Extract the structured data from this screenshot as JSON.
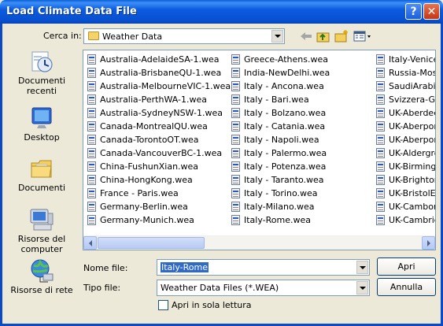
{
  "window": {
    "title": "Load Climate Data File",
    "help_label": "?",
    "close_label": "✕"
  },
  "toolbar": {
    "look_in_label": "Cerca in:",
    "look_in_value": "Weather Data",
    "icons": [
      "back-arrow-icon",
      "up-folder-icon",
      "new-folder-icon",
      "view-menu-icon"
    ]
  },
  "places": [
    {
      "name": "recent",
      "label": "Documenti recenti",
      "icon": "recent-documents-icon"
    },
    {
      "name": "desktop",
      "label": "Desktop",
      "icon": "desktop-icon"
    },
    {
      "name": "documents",
      "label": "Documenti",
      "icon": "documents-folder-icon"
    },
    {
      "name": "computer",
      "label": "Risorse del computer",
      "icon": "computer-icon"
    },
    {
      "name": "network",
      "label": "Risorse di rete",
      "icon": "network-icon"
    }
  ],
  "files": {
    "col1": [
      "Australia-AdelaideSA-1.wea",
      "Australia-BrisbaneQU-1.wea",
      "Australia-MelbourneVIC-1.wea",
      "Australia-PerthWA-1.wea",
      "Australia-SydneyNSW-1.wea",
      "Canada-MontrealQU.wea",
      "Canada-TorontoOT.wea",
      "Canada-VancouverBC-1.wea",
      "China-FushunXian.wea",
      "China-HongKong.wea",
      "France - Paris.wea",
      "Germany-Berlin.wea",
      "Germany-Munich.wea"
    ],
    "col2": [
      "Greece-Athens.wea",
      "India-NewDelhi.wea",
      "Italy -  Ancona.wea",
      "Italy - Bari.wea",
      "Italy - Bolzano.wea",
      "Italy - Catania.wea",
      "Italy - Napoli.wea",
      "Italy - Palermo.wea",
      "Italy - Potenza.wea",
      "Italy - Taranto.wea",
      "Italy - Torino.wea",
      "Italy-Milano.wea",
      "Italy-Rome.wea"
    ],
    "col3": [
      "Italy-Venice.",
      "Russia-Mosco",
      "SaudiArabia-",
      "Svizzera-Gine",
      "UK-Aberdeen",
      "UK-Aberport",
      "UK-Aberport",
      "UK-Aldergrov",
      "UK-Birmingha",
      "UK-BrightonE",
      "UK-BristolE.w",
      "UK-Camborn",
      "UK-Cambridg"
    ]
  },
  "form": {
    "filename_label": "Nome file:",
    "filename_value": "Italy-Rome",
    "filetype_label": "Tipo file:",
    "filetype_value": "Weather Data Files (*.WEA)",
    "readonly_label": "Apri in sola lettura",
    "readonly_checked": false,
    "open_label": "Apri",
    "cancel_label": "Annulla"
  },
  "colors": {
    "titlebar": "#0a5fd8",
    "dialog_bg": "#ece9d8",
    "selection": "#316ac5"
  }
}
